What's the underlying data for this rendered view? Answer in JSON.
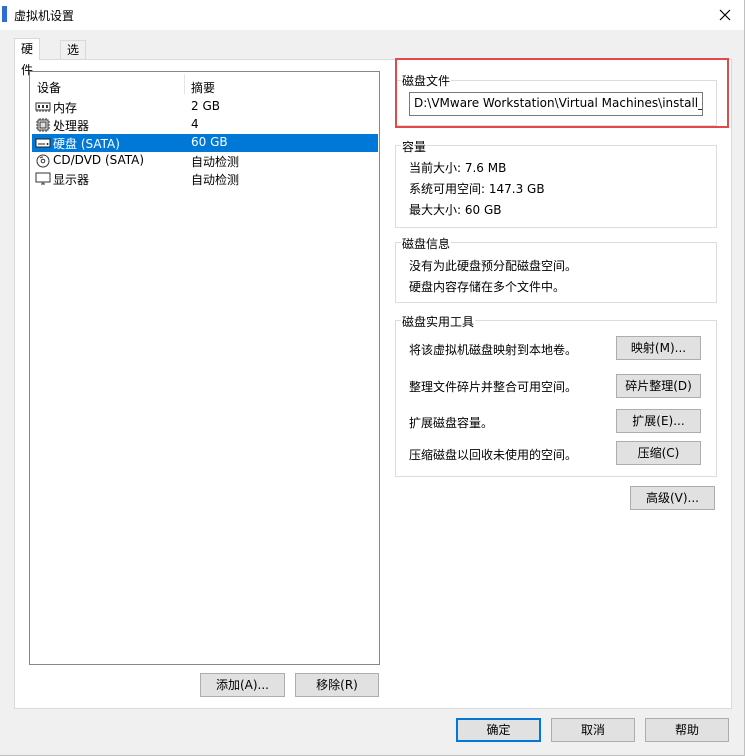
{
  "window": {
    "title": "虚拟机设置"
  },
  "tabs": [
    {
      "label": "硬件",
      "active": true
    },
    {
      "label": "选项",
      "active": false
    }
  ],
  "device_list": {
    "columns": [
      "设备",
      "摘要"
    ],
    "rows": [
      {
        "icon": "memory-icon",
        "name": "内存",
        "summary": "2 GB",
        "selected": false
      },
      {
        "icon": "cpu-icon",
        "name": "处理器",
        "summary": "4",
        "selected": false
      },
      {
        "icon": "hard-disk-icon",
        "name": "硬盘 (SATA)",
        "summary": "60 GB",
        "selected": true
      },
      {
        "icon": "cd-dvd-icon",
        "name": "CD/DVD (SATA)",
        "summary": "自动检测",
        "selected": false
      },
      {
        "icon": "monitor-icon",
        "name": "显示器",
        "summary": "自动检测",
        "selected": false
      }
    ],
    "add_button": "添加(A)...",
    "remove_button": "移除(R)"
  },
  "disk_file": {
    "label": "磁盘文件",
    "path": "D:\\VMware Workstation\\Virtual Machines\\install_win"
  },
  "capacity": {
    "label": "容量",
    "current_size": "当前大小: 7.6 MB",
    "system_available": "系统可用空间: 147.3 GB",
    "max_size": "最大大小: 60 GB"
  },
  "disk_info": {
    "label": "磁盘信息",
    "line1": "没有为此硬盘预分配磁盘空间。",
    "line2": "硬盘内容存储在多个文件中。"
  },
  "disk_utilities": {
    "label": "磁盘实用工具",
    "map_desc": "将该虚拟机磁盘映射到本地卷。",
    "map_button": "映射(M)...",
    "defrag_desc": "整理文件碎片并整合可用空间。",
    "defrag_button": "碎片整理(D)",
    "expand_desc": "扩展磁盘容量。",
    "expand_button": "扩展(E)...",
    "compact_desc": "压缩磁盘以回收未使用的空间。",
    "compact_button": "压缩(C)"
  },
  "advanced_button": "高级(V)...",
  "footer": {
    "ok": "确定",
    "cancel": "取消",
    "help": "帮助"
  },
  "colors": {
    "selection": "#0078d7",
    "highlight_box": "#e24a4a",
    "window_bg": "#f0f0f0"
  }
}
